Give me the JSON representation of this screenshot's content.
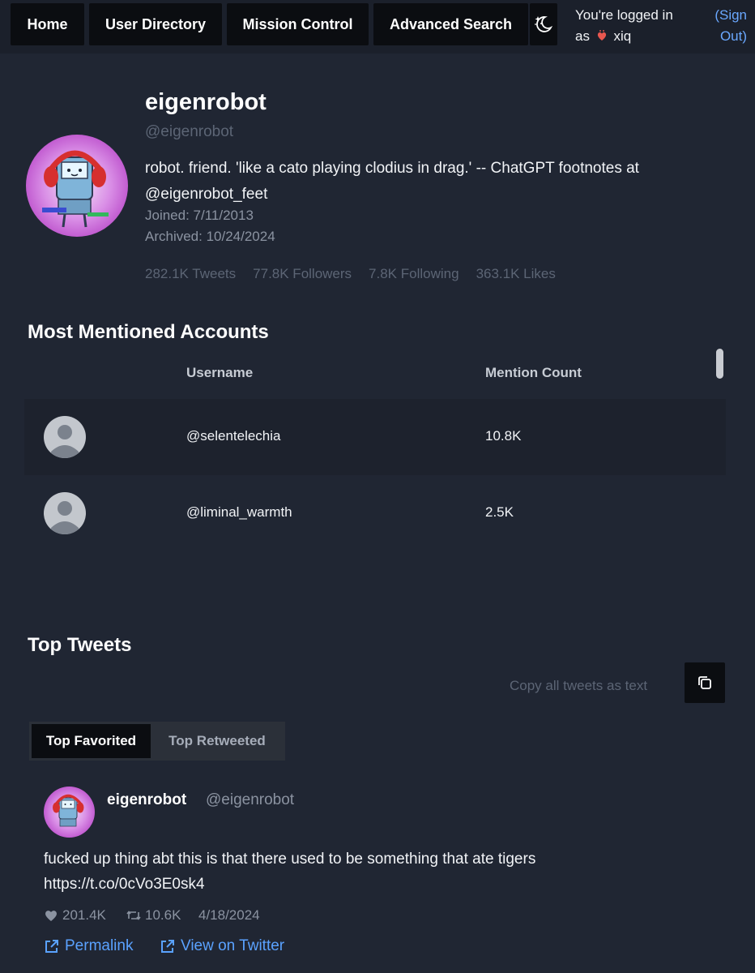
{
  "nav": {
    "items": [
      "Home",
      "User Directory",
      "Mission Control",
      "Advanced Search"
    ],
    "login_line1": "You're logged in",
    "login_as": "as",
    "login_user": "xiq",
    "signout_line1": "(Sign",
    "signout_line2": "Out)"
  },
  "profile": {
    "name": "eigenrobot",
    "handle": "@eigenrobot",
    "bio_line1": "robot. friend. 'like a cato playing clodius in drag.' -- ChatGPT footnotes at",
    "bio_line2": "@eigenrobot_feet",
    "joined": "Joined: 7/11/2013",
    "archived": "Archived: 10/24/2024",
    "stats": [
      "282.1K Tweets",
      "77.8K Followers",
      "7.8K Following",
      "363.1K Likes"
    ]
  },
  "mentions": {
    "title": "Most Mentioned Accounts",
    "col_username": "Username",
    "col_count": "Mention Count",
    "rows": [
      {
        "username": "@selentelechia",
        "count": "10.8K"
      },
      {
        "username": "@liminal_warmth",
        "count": "2.5K"
      }
    ]
  },
  "top_tweets": {
    "title": "Top Tweets",
    "copy_label": "Copy all tweets as text",
    "tabs": [
      "Top Favorited",
      "Top Retweeted"
    ],
    "tweet": {
      "name": "eigenrobot",
      "handle": "@eigenrobot",
      "text_line1": "fucked up thing abt this is that there used to be something that ate tigers",
      "text_line2": "https://t.co/0cVo3E0sk4",
      "likes": "201.4K",
      "retweets": "10.6K",
      "date": "4/18/2024",
      "permalink": "Permalink",
      "view_twitter": "View on Twitter"
    }
  }
}
